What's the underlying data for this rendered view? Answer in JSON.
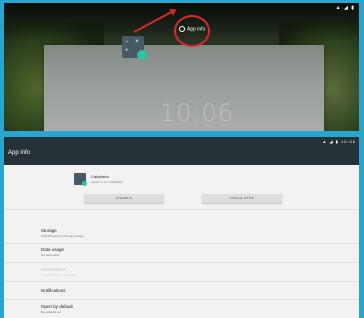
{
  "top": {
    "target_label": "App info",
    "status_icons": "▲ ◢ ▮",
    "clock": "10:06",
    "dragged_app_symbols": [
      "−",
      "×",
      "+",
      "="
    ]
  },
  "app_info": {
    "title": "App info",
    "status_bar": "▲ ◢ ▮ 10:06",
    "app_name": "Calculator",
    "app_version": "version 7.1.2 (4223425)",
    "buttons": {
      "disable": "DISABLE",
      "force_stop": "FORCE STOP"
    },
    "rows": [
      {
        "title": "Storage",
        "subtitle": "8.00 KB used in internal storage",
        "enabled": true
      },
      {
        "title": "Data usage",
        "subtitle": "No data used",
        "enabled": true
      },
      {
        "title": "Permissions",
        "subtitle": "No permissions requested",
        "enabled": false
      },
      {
        "title": "Notifications",
        "subtitle": "",
        "enabled": true
      },
      {
        "title": "Open by default",
        "subtitle": "No defaults set",
        "enabled": true
      }
    ]
  },
  "colors": {
    "frame_blue": "#29a6ce",
    "app_bar": "#263238",
    "highlight_red": "#d42a2a",
    "calculator_accent": "#26c6a8"
  }
}
